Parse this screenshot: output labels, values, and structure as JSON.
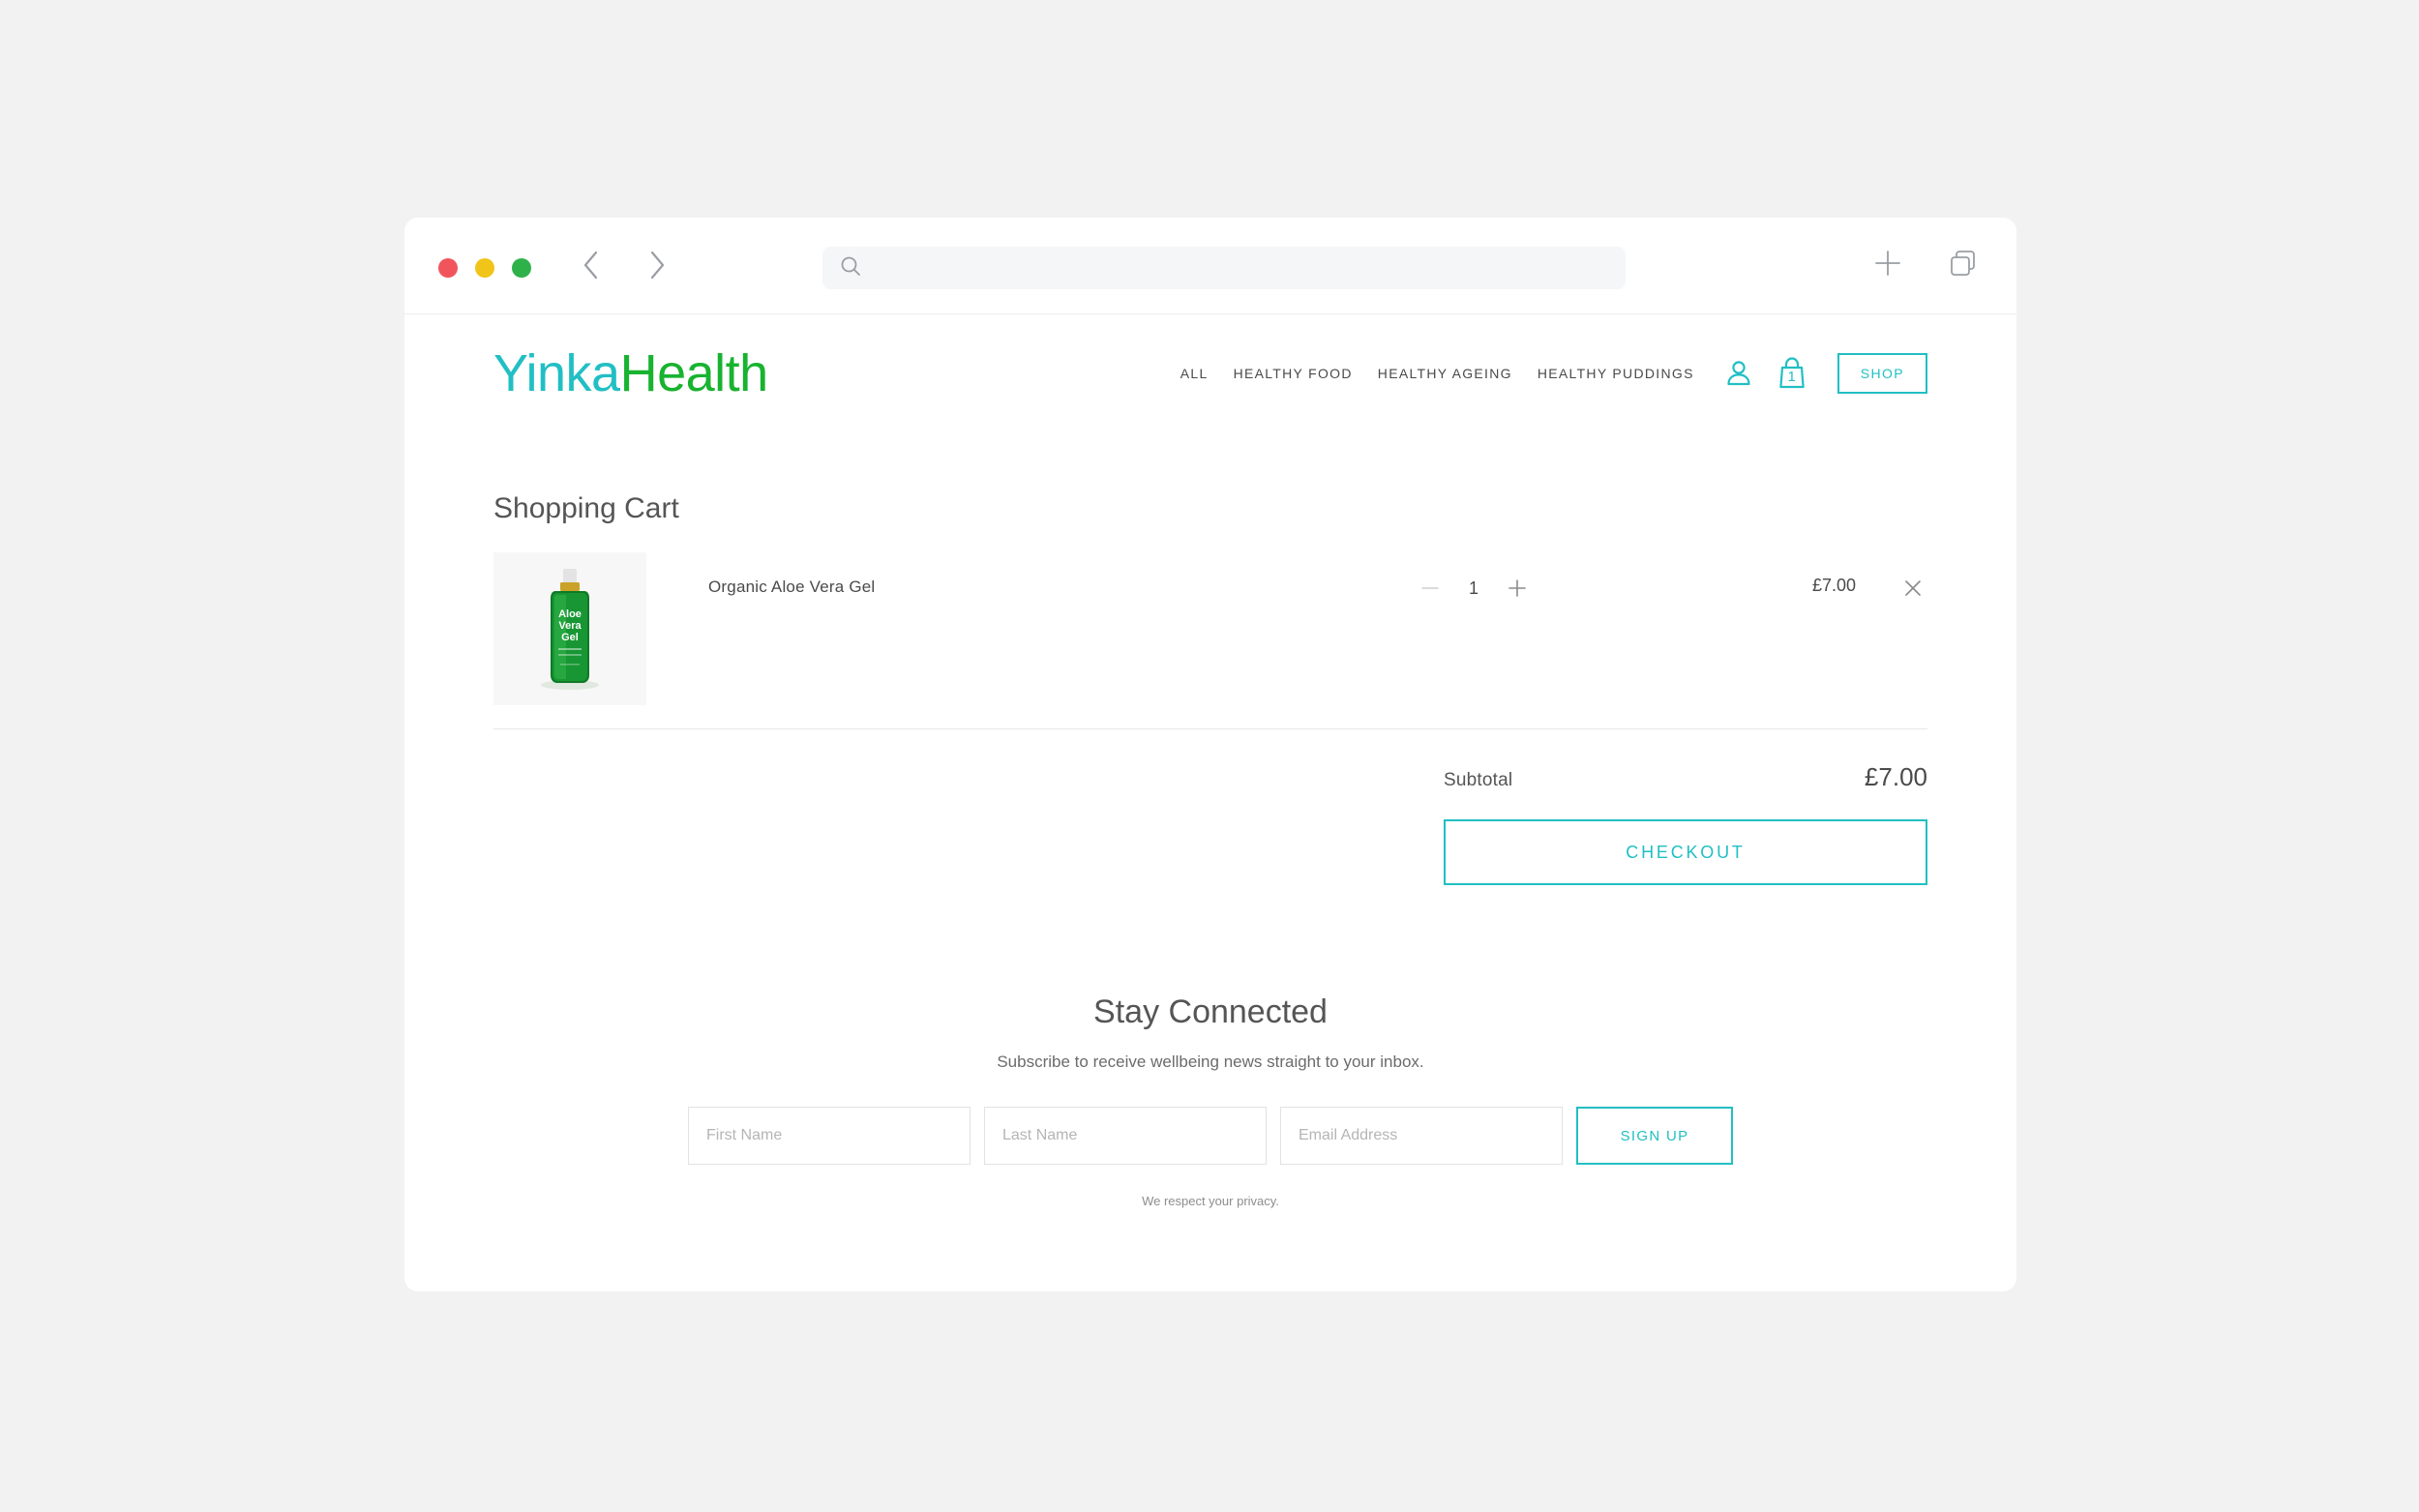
{
  "browser": {
    "address_value": "",
    "address_placeholder": "",
    "icons": {
      "search": "search-icon",
      "back": "back-chevron-icon",
      "forward": "forward-chevron-icon",
      "new_tab": "plus-icon",
      "tabs_overview": "tabs-overview-icon"
    },
    "traffic_lights": {
      "close_color": "#f2545b",
      "minimize_color": "#f0c419",
      "zoom_color": "#2fb14a"
    }
  },
  "site": {
    "logo": {
      "part_one": "Yinka",
      "part_two": "Health",
      "part_one_color": "#21bfc4",
      "part_two_color": "#18b330"
    },
    "nav": [
      {
        "label": "ALL"
      },
      {
        "label": "HEALTHY FOOD"
      },
      {
        "label": "HEALTHY AGEING"
      },
      {
        "label": "HEALTHY PUDDINGS"
      }
    ],
    "account_icon": "account-person-icon",
    "cart": {
      "icon": "shopping-bag-icon",
      "count": "1"
    },
    "shop_button": "SHOP",
    "accent_color": "#21bfc4"
  },
  "cart": {
    "title": "Shopping Cart",
    "items": [
      {
        "name": "Organic Aloe Vera Gel",
        "quantity": "1",
        "price": "£7.00",
        "decrement_label": "−",
        "increment_label": "+",
        "remove_label": "×",
        "thumbnail": "aloe-vera-gel-bottle"
      }
    ],
    "subtotal_label": "Subtotal",
    "subtotal_value": "£7.00",
    "checkout_label": "CHECKOUT"
  },
  "newsletter": {
    "title": "Stay Connected",
    "subtitle": "Subscribe to receive wellbeing news straight to your inbox.",
    "fields": [
      {
        "name": "first-name",
        "placeholder": "First Name",
        "value": ""
      },
      {
        "name": "last-name",
        "placeholder": "Last Name",
        "value": ""
      },
      {
        "name": "email",
        "placeholder": "Email Address",
        "value": ""
      }
    ],
    "signup_label": "SIGN UP",
    "privacy_note": "We respect your privacy."
  }
}
